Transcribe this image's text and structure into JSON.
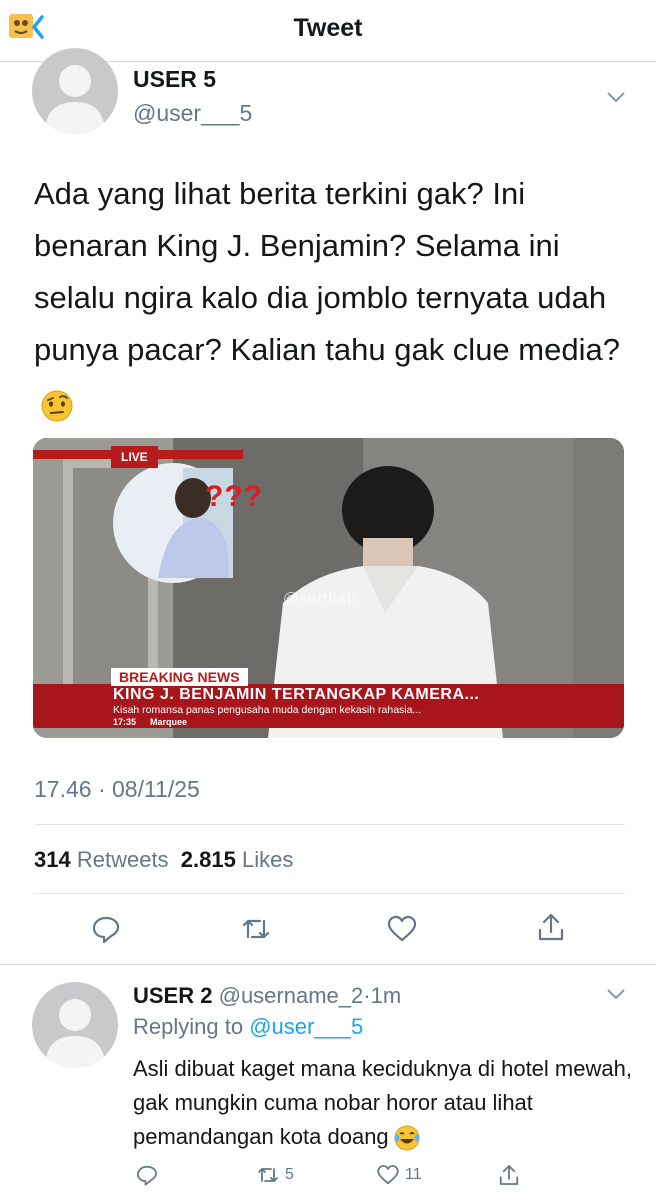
{
  "nav": {
    "title": "Tweet",
    "back_icon": "back-arrow-icon"
  },
  "tweet": {
    "name": "USER 5",
    "handle": "@user___5",
    "text": "Ada yang lihat berita terkini gak? Ini benaran King J. Benjamin? Selama ini selalu ngira kalo dia jomblo ternyata udah punya pacar? Kalian tahu gak clue media?",
    "emoji": "raised-eyebrow-emoji",
    "media": {
      "live_label": "LIVE",
      "question_marks": "???",
      "watermark": "@sorthati",
      "breaking_label": "BREAKING NEWS",
      "headline": "KING J. BENJAMIN TERTANGKAP KAMERA...",
      "subline": "Kisah romansa panas pengusaha muda dengan kekasih rahasia...",
      "ticker_time": "17:35",
      "ticker_label": "Marquee"
    },
    "timestamp": "17.46 · 08/11/25",
    "retweets_count": "314",
    "retweets_label": "Retweets",
    "likes_count": "2.815",
    "likes_label": "Likes",
    "actions": [
      "reply-icon",
      "retweet-icon",
      "like-icon",
      "share-icon"
    ]
  },
  "reply": {
    "name": "USER 2",
    "handle": "@username_2",
    "time": "1m",
    "replying_label": "Replying to",
    "replying_to": "@user___5",
    "text": "Asli dibuat kaget mana keciduknya di hotel mewah, gak mungkin cuma nobar horor atau lihat pemandangan kota doang",
    "emoji": "laughing-tears-emoji",
    "retweet_count": "5",
    "like_count": "11"
  },
  "colors": {
    "accent": "#1da1f2",
    "muted": "#657786",
    "breaking_red": "#a8161b"
  }
}
